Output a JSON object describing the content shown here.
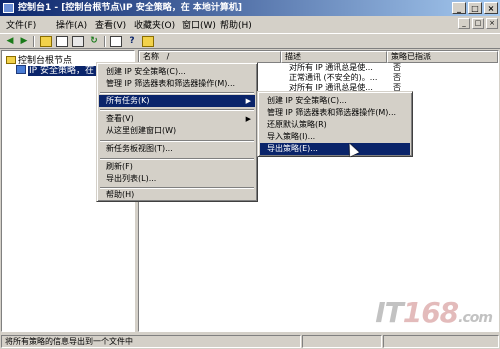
{
  "window": {
    "title": "控制台1 - [控制台根节点\\IP 安全策略，在 本地计算机]"
  },
  "titlebar_buttons": [
    "_",
    "□",
    "×"
  ],
  "menubar": {
    "items": [
      "文件(F)",
      "操作(A)",
      "查看(V)",
      "收藏夹(O)",
      "窗口(W)",
      "帮助(H)"
    ],
    "mdi_buttons": [
      "_",
      "□",
      "×"
    ]
  },
  "toolbar": {
    "buttons": [
      "back-icon",
      "forward-icon",
      "up-folder-icon",
      "show-tree-icon",
      "export-icon",
      "refresh-icon",
      "properties-icon",
      "help-icon",
      "new-policy-icon"
    ]
  },
  "tree": {
    "root": "控制台根节点",
    "child": "IP 安全策略，在 本"
  },
  "columns": [
    "名称",
    "/",
    "描述",
    "策略已指派"
  ],
  "rows": [
    {
      "desc": "对所有 IP 通讯总是使...",
      "assigned": "否"
    },
    {
      "desc": "正常通讯 (不安全的)。...",
      "assigned": "否"
    },
    {
      "desc": "对所有 IP 通讯总是使...",
      "assigned": "否"
    }
  ],
  "context_menu": {
    "items": [
      {
        "label": "创建 IP 安全策略(C)...",
        "submenu": false
      },
      {
        "label": "管理 IP 筛选器表和筛选器操作(M)...",
        "submenu": false
      },
      {
        "label": "所有任务(K)",
        "submenu": true,
        "highlighted": true
      },
      {
        "label": "查看(V)",
        "submenu": true
      },
      {
        "label": "从这里创建窗口(W)",
        "submenu": false
      },
      {
        "label": "新任务板视图(T)...",
        "submenu": false
      },
      {
        "label": "刷新(F)",
        "submenu": false
      },
      {
        "label": "导出列表(L)...",
        "submenu": false
      },
      {
        "label": "帮助(H)",
        "submenu": false
      }
    ]
  },
  "submenu": {
    "items": [
      {
        "label": "创建 IP 安全策略(C)..."
      },
      {
        "label": "管理 IP 筛选器表和筛选器操作(M)..."
      },
      {
        "label": "还原默认策略(R)"
      },
      {
        "label": "导入策略(I)..."
      },
      {
        "label": "导出策略(E)...",
        "highlighted": true
      }
    ]
  },
  "statusbar": {
    "text": "将所有策略的信息导出到一个文件中"
  },
  "watermark": {
    "prefix": "IT",
    "number": "168",
    "suffix": ".com"
  },
  "colors": {
    "title_start": "#0a246a",
    "title_end": "#a6caf0",
    "highlight": "#0a246a",
    "face": "#d4d0c8"
  }
}
